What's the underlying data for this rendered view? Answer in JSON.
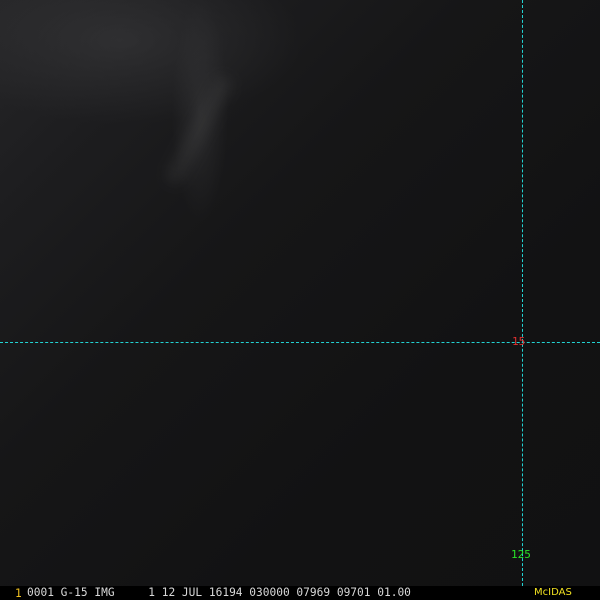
{
  "window": {
    "app": "McIDAS"
  },
  "image": {
    "description_free": true
  },
  "crosshair": {
    "line_color": "#22d3d3",
    "lat_label": "15",
    "lat_label_color": "#e03030",
    "lon_label": "125",
    "lon_label_color": "#28e028"
  },
  "status_bar": {
    "frame_number": "1",
    "header": "0001 G-15 IMG     1 12 JUL 16194 030000 07969 09701 01.00",
    "brand": "McIDAS",
    "frame_color": "#f0c020",
    "brand_color": "#f0e020"
  }
}
